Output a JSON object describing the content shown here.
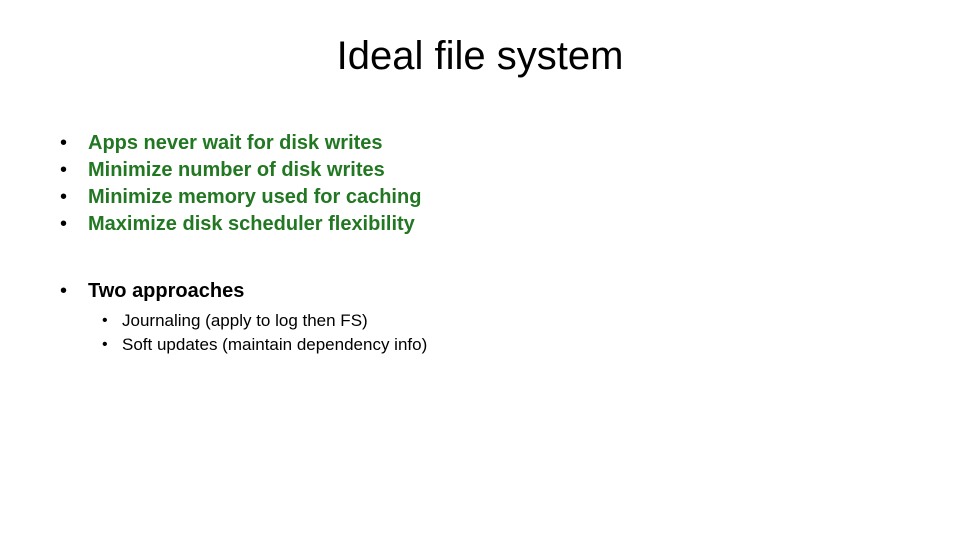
{
  "title": "Ideal file system",
  "block1": {
    "items": [
      "Apps never wait for disk writes",
      "Minimize number of disk writes",
      "Minimize memory used for caching",
      "Maximize disk scheduler flexibility"
    ]
  },
  "block2": {
    "heading": "Two approaches",
    "sub": [
      "Journaling (apply to log then FS)",
      "Soft updates (maintain dependency info)"
    ]
  }
}
